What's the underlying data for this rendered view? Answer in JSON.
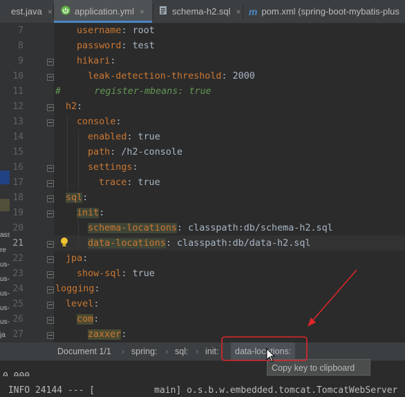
{
  "tabs": [
    {
      "label": "est.java",
      "icon": "java-class-icon"
    },
    {
      "label": "application.yml",
      "icon": "spring-config-icon"
    },
    {
      "label": "schema-h2.sql",
      "icon": "sql-file-icon"
    },
    {
      "label": "pom.xml (spring-boot-mybatis-plus",
      "icon": "maven-icon"
    }
  ],
  "tab_close": "×",
  "editor": {
    "lines": [
      {
        "n": "7"
      },
      {
        "n": "8"
      },
      {
        "n": "9"
      },
      {
        "n": "10"
      },
      {
        "n": "11"
      },
      {
        "n": "12"
      },
      {
        "n": "13"
      },
      {
        "n": "14"
      },
      {
        "n": "15"
      },
      {
        "n": "16"
      },
      {
        "n": "17"
      },
      {
        "n": "18"
      },
      {
        "n": "19"
      },
      {
        "n": "20"
      },
      {
        "n": "21"
      },
      {
        "n": "22"
      },
      {
        "n": "23"
      },
      {
        "n": "24"
      },
      {
        "n": "25"
      },
      {
        "n": "26"
      },
      {
        "n": "27"
      }
    ],
    "code": {
      "l7_key": "username",
      "l7_val": " root",
      "l8_key": "password",
      "l8_val": " test",
      "l9_key": "hikari",
      "l10_key": "leak-detection-threshold",
      "l10_val": " 2000",
      "l11_comment": "#      register-mbeans: true",
      "l12_key": "h2",
      "l13_key": "console",
      "l14_key": "enabled",
      "l14_val": " true",
      "l15_key": "path",
      "l15_val": " /h2-console",
      "l16_key": "settings",
      "l17_key": "trace",
      "l17_val": " true",
      "l18_key": "sql",
      "l19_key": "init",
      "l20_key": "schema-locations",
      "l20_val": " classpath:db/schema-h2.sql",
      "l21_key": "data-locations",
      "l21_val": " classpath:db/data-h2.sql",
      "l22_key": "jpa",
      "l23_key": "show-sql",
      "l23_val": " true",
      "l24_key": "logging",
      "l25_key": "level",
      "l26_key": "com",
      "l27_key": "zaxxer"
    },
    "colon": ":"
  },
  "breadcrumb": {
    "items": [
      "Document 1/1",
      "spring:",
      "sql:",
      "init:",
      "data-locations:"
    ],
    "separator": "›"
  },
  "tooltip": "Copy key to clipboard",
  "console": {
    "partial": "0.000",
    "line": " INFO 24144 --- [           main] o.s.b.w.embedded.tomcat.TomcatWebServer"
  },
  "side_fragments": [
    "ass",
    "re",
    "us-",
    "us-",
    "us-",
    "us-",
    "us-",
    "us-",
    "ja",
    "ja"
  ],
  "colors": {
    "accent": "#4a88c7",
    "annotation": "#e0262b",
    "key": "#cc7832",
    "comment": "#629755"
  }
}
